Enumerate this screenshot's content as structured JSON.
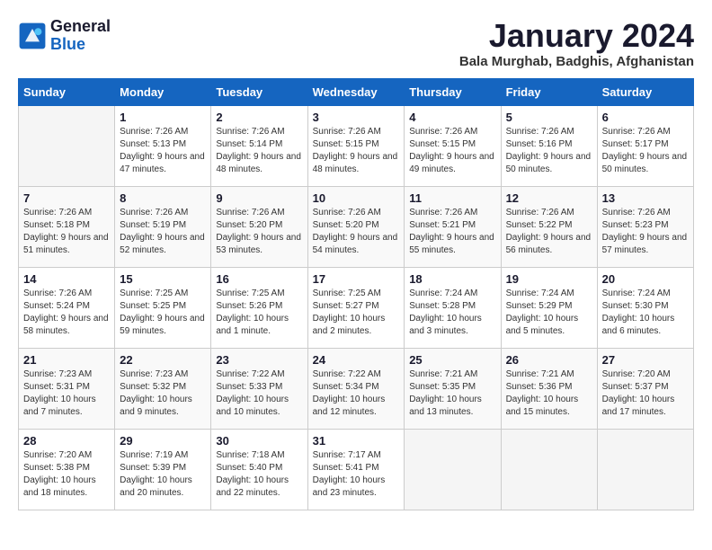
{
  "logo": {
    "line1": "General",
    "line2": "Blue"
  },
  "title": "January 2024",
  "location": "Bala Murghab, Badghis, Afghanistan",
  "days_header": [
    "Sunday",
    "Monday",
    "Tuesday",
    "Wednesday",
    "Thursday",
    "Friday",
    "Saturday"
  ],
  "weeks": [
    [
      {
        "day": "",
        "sunrise": "",
        "sunset": "",
        "daylight": ""
      },
      {
        "day": "1",
        "sunrise": "Sunrise: 7:26 AM",
        "sunset": "Sunset: 5:13 PM",
        "daylight": "Daylight: 9 hours and 47 minutes."
      },
      {
        "day": "2",
        "sunrise": "Sunrise: 7:26 AM",
        "sunset": "Sunset: 5:14 PM",
        "daylight": "Daylight: 9 hours and 48 minutes."
      },
      {
        "day": "3",
        "sunrise": "Sunrise: 7:26 AM",
        "sunset": "Sunset: 5:15 PM",
        "daylight": "Daylight: 9 hours and 48 minutes."
      },
      {
        "day": "4",
        "sunrise": "Sunrise: 7:26 AM",
        "sunset": "Sunset: 5:15 PM",
        "daylight": "Daylight: 9 hours and 49 minutes."
      },
      {
        "day": "5",
        "sunrise": "Sunrise: 7:26 AM",
        "sunset": "Sunset: 5:16 PM",
        "daylight": "Daylight: 9 hours and 50 minutes."
      },
      {
        "day": "6",
        "sunrise": "Sunrise: 7:26 AM",
        "sunset": "Sunset: 5:17 PM",
        "daylight": "Daylight: 9 hours and 50 minutes."
      }
    ],
    [
      {
        "day": "7",
        "sunrise": "Sunrise: 7:26 AM",
        "sunset": "Sunset: 5:18 PM",
        "daylight": "Daylight: 9 hours and 51 minutes."
      },
      {
        "day": "8",
        "sunrise": "Sunrise: 7:26 AM",
        "sunset": "Sunset: 5:19 PM",
        "daylight": "Daylight: 9 hours and 52 minutes."
      },
      {
        "day": "9",
        "sunrise": "Sunrise: 7:26 AM",
        "sunset": "Sunset: 5:20 PM",
        "daylight": "Daylight: 9 hours and 53 minutes."
      },
      {
        "day": "10",
        "sunrise": "Sunrise: 7:26 AM",
        "sunset": "Sunset: 5:20 PM",
        "daylight": "Daylight: 9 hours and 54 minutes."
      },
      {
        "day": "11",
        "sunrise": "Sunrise: 7:26 AM",
        "sunset": "Sunset: 5:21 PM",
        "daylight": "Daylight: 9 hours and 55 minutes."
      },
      {
        "day": "12",
        "sunrise": "Sunrise: 7:26 AM",
        "sunset": "Sunset: 5:22 PM",
        "daylight": "Daylight: 9 hours and 56 minutes."
      },
      {
        "day": "13",
        "sunrise": "Sunrise: 7:26 AM",
        "sunset": "Sunset: 5:23 PM",
        "daylight": "Daylight: 9 hours and 57 minutes."
      }
    ],
    [
      {
        "day": "14",
        "sunrise": "Sunrise: 7:26 AM",
        "sunset": "Sunset: 5:24 PM",
        "daylight": "Daylight: 9 hours and 58 minutes."
      },
      {
        "day": "15",
        "sunrise": "Sunrise: 7:25 AM",
        "sunset": "Sunset: 5:25 PM",
        "daylight": "Daylight: 9 hours and 59 minutes."
      },
      {
        "day": "16",
        "sunrise": "Sunrise: 7:25 AM",
        "sunset": "Sunset: 5:26 PM",
        "daylight": "Daylight: 10 hours and 1 minute."
      },
      {
        "day": "17",
        "sunrise": "Sunrise: 7:25 AM",
        "sunset": "Sunset: 5:27 PM",
        "daylight": "Daylight: 10 hours and 2 minutes."
      },
      {
        "day": "18",
        "sunrise": "Sunrise: 7:24 AM",
        "sunset": "Sunset: 5:28 PM",
        "daylight": "Daylight: 10 hours and 3 minutes."
      },
      {
        "day": "19",
        "sunrise": "Sunrise: 7:24 AM",
        "sunset": "Sunset: 5:29 PM",
        "daylight": "Daylight: 10 hours and 5 minutes."
      },
      {
        "day": "20",
        "sunrise": "Sunrise: 7:24 AM",
        "sunset": "Sunset: 5:30 PM",
        "daylight": "Daylight: 10 hours and 6 minutes."
      }
    ],
    [
      {
        "day": "21",
        "sunrise": "Sunrise: 7:23 AM",
        "sunset": "Sunset: 5:31 PM",
        "daylight": "Daylight: 10 hours and 7 minutes."
      },
      {
        "day": "22",
        "sunrise": "Sunrise: 7:23 AM",
        "sunset": "Sunset: 5:32 PM",
        "daylight": "Daylight: 10 hours and 9 minutes."
      },
      {
        "day": "23",
        "sunrise": "Sunrise: 7:22 AM",
        "sunset": "Sunset: 5:33 PM",
        "daylight": "Daylight: 10 hours and 10 minutes."
      },
      {
        "day": "24",
        "sunrise": "Sunrise: 7:22 AM",
        "sunset": "Sunset: 5:34 PM",
        "daylight": "Daylight: 10 hours and 12 minutes."
      },
      {
        "day": "25",
        "sunrise": "Sunrise: 7:21 AM",
        "sunset": "Sunset: 5:35 PM",
        "daylight": "Daylight: 10 hours and 13 minutes."
      },
      {
        "day": "26",
        "sunrise": "Sunrise: 7:21 AM",
        "sunset": "Sunset: 5:36 PM",
        "daylight": "Daylight: 10 hours and 15 minutes."
      },
      {
        "day": "27",
        "sunrise": "Sunrise: 7:20 AM",
        "sunset": "Sunset: 5:37 PM",
        "daylight": "Daylight: 10 hours and 17 minutes."
      }
    ],
    [
      {
        "day": "28",
        "sunrise": "Sunrise: 7:20 AM",
        "sunset": "Sunset: 5:38 PM",
        "daylight": "Daylight: 10 hours and 18 minutes."
      },
      {
        "day": "29",
        "sunrise": "Sunrise: 7:19 AM",
        "sunset": "Sunset: 5:39 PM",
        "daylight": "Daylight: 10 hours and 20 minutes."
      },
      {
        "day": "30",
        "sunrise": "Sunrise: 7:18 AM",
        "sunset": "Sunset: 5:40 PM",
        "daylight": "Daylight: 10 hours and 22 minutes."
      },
      {
        "day": "31",
        "sunrise": "Sunrise: 7:17 AM",
        "sunset": "Sunset: 5:41 PM",
        "daylight": "Daylight: 10 hours and 23 minutes."
      },
      {
        "day": "",
        "sunrise": "",
        "sunset": "",
        "daylight": ""
      },
      {
        "day": "",
        "sunrise": "",
        "sunset": "",
        "daylight": ""
      },
      {
        "day": "",
        "sunrise": "",
        "sunset": "",
        "daylight": ""
      }
    ]
  ]
}
